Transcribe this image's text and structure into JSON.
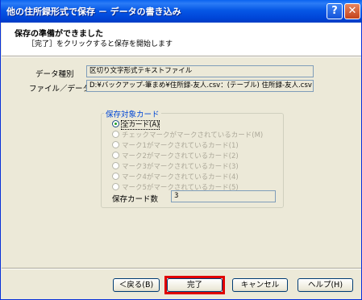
{
  "window": {
    "title": "他の住所録形式で保存 － データの書き込み",
    "help_glyph": "?",
    "close_glyph": "✕"
  },
  "header": {
    "title": "保存の準備ができました",
    "subtitle": "［完了］をクリックすると保存を開始します"
  },
  "fields": {
    "data_type_label": "データ種別",
    "data_type_value": "区切り文字形式テキストファイル",
    "file_label": "ファイル／データ",
    "file_value": "D:¥バックアップ-筆まめ¥住所録-友人.csv：(テーブル) 住所録-友人.csv"
  },
  "save_target": {
    "legend": "保存対象カード",
    "options": [
      {
        "label": "全カード(A)",
        "selected": true,
        "enabled": true
      },
      {
        "label": "チェックマークがマークされているカード(M)",
        "selected": false,
        "enabled": false
      },
      {
        "label": "マーク1がマークされているカード(1)",
        "selected": false,
        "enabled": false
      },
      {
        "label": "マーク2がマークされているカード(2)",
        "selected": false,
        "enabled": false
      },
      {
        "label": "マーク3がマークされているカード(3)",
        "selected": false,
        "enabled": false
      },
      {
        "label": "マーク4がマークされているカード(4)",
        "selected": false,
        "enabled": false
      },
      {
        "label": "マーク5がマークされているカード(5)",
        "selected": false,
        "enabled": false
      }
    ],
    "count_label": "保存カード数",
    "count_value": "3"
  },
  "buttons": {
    "back": "＜戻る(B)",
    "finish": "完了",
    "cancel": "キャンセル",
    "help": "ヘルプ(H)"
  },
  "colors": {
    "title_bar": "#0058e6",
    "highlight": "#e00000",
    "legend_text": "#0046d5"
  }
}
